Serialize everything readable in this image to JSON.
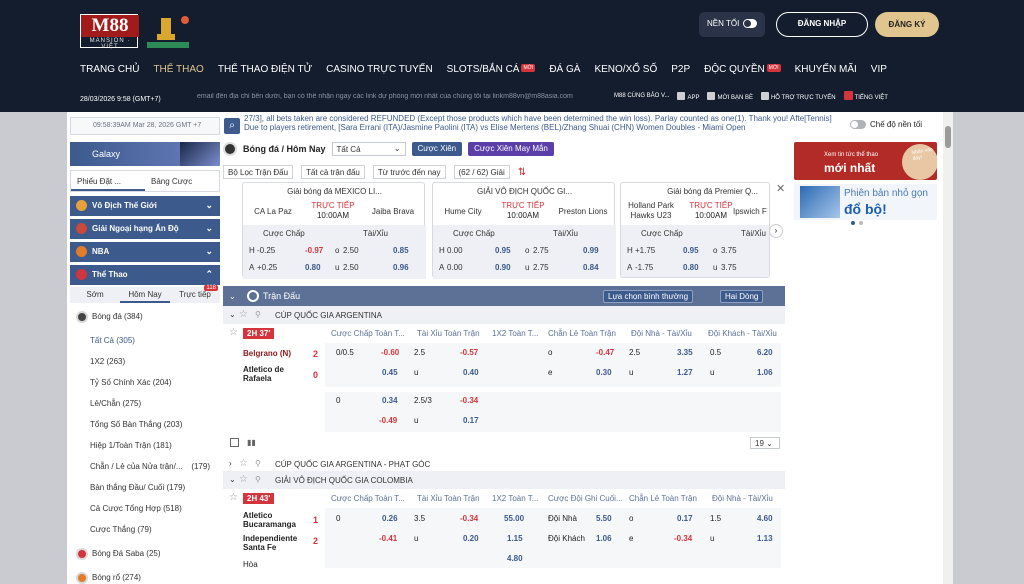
{
  "brand": {
    "logo": "M88",
    "logo_sub": "MANSION · VIỆT"
  },
  "header": {
    "theme_label": "NỀN TỐI",
    "login": "ĐĂNG NHẬP",
    "register": "ĐĂNG KÝ"
  },
  "nav": [
    {
      "label": "TRANG CHỦ",
      "badge": ""
    },
    {
      "label": "THỂ THAO",
      "badge": ""
    },
    {
      "label": "THỂ THAO ĐIỆN TỬ",
      "badge": ""
    },
    {
      "label": "CASINO TRỰC TUYẾN",
      "badge": ""
    },
    {
      "label": "SLOTS/BẮN CÁ",
      "badge": "MỚI"
    },
    {
      "label": "ĐÁ GÀ",
      "badge": ""
    },
    {
      "label": "KENO/XỔ SỐ",
      "badge": ""
    },
    {
      "label": "P2P",
      "badge": ""
    },
    {
      "label": "ĐỘC QUYỀN",
      "badge": "MỚI"
    },
    {
      "label": "KHUYẾN MÃI",
      "badge": ""
    },
    {
      "label": "VIP",
      "badge": ""
    }
  ],
  "infobar": {
    "datetime": "28/03/2026 9:58 (GMT+7)",
    "marquee": "email đến địa chỉ bên dưới, bạn có thể nhận ngay các link dự phòng mới nhất của chúng tôi tại linkm88vn@m88asia.com",
    "links": [
      "M88 CÙNG BẢO V...",
      "APP",
      "MỜI BẠN BÈ",
      "HỖ TRỢ TRỰC TUYẾN",
      "TIẾNG VIỆT"
    ]
  },
  "topbar": {
    "clock": "09:58:39AM Mar 28, 2026 GMT +7",
    "announcement": "27/3], all bets taken are considered REFUNDED (Except those products which have been determined the win loss). Parlay counted as one(1). Thank you! Afte[Tennis] Due to players retirement, [Sara Errani (ITA)/Jasmine Paolini (ITA) vs Elise Mertens (BEL)/Zhang Shuai (CHN) Women Doubles - Miami Open",
    "night_mode": "Chế độ nền tối"
  },
  "sidebar": {
    "galaxy": "Galaxy",
    "tabs": [
      "Phiếu Đặt ...",
      "Bảng Cược"
    ],
    "sections": [
      "Vô Địch Thế Giới",
      "Giải Ngoại hạng Ấn Độ",
      "NBA",
      "Thể Thao"
    ],
    "subtabs": [
      "Sớm",
      "Hôm Nay",
      "Trực tiếp"
    ],
    "live_count": "118",
    "items": [
      {
        "label": "Bóng đá",
        "count": "(384)"
      },
      {
        "label": "Tất Cả",
        "count": "(305)"
      },
      {
        "label": "1X2",
        "count": "(263)"
      },
      {
        "label": "Tỷ Số Chính Xác",
        "count": "(204)"
      },
      {
        "label": "Lẻ/Chẵn",
        "count": "(275)"
      },
      {
        "label": "Tổng Số Bàn Thắng",
        "count": "(203)"
      },
      {
        "label": "Hiệp 1/Toàn Trận",
        "count": "(181)"
      },
      {
        "label": "Chẵn / Lẻ của Nửa trận/...",
        "count": "(179)"
      },
      {
        "label": "Bàn thắng Đầu/ Cuối",
        "count": "(179)"
      },
      {
        "label": "Cả Cược Tổng Hợp",
        "count": "(518)"
      },
      {
        "label": "Cược Thắng",
        "count": "(79)"
      },
      {
        "label": "Bóng Đá Saba",
        "count": "(25)"
      },
      {
        "label": "Bóng rổ",
        "count": "(274)"
      }
    ]
  },
  "center": {
    "title": "Bóng đá / Hôm Nay",
    "select": "Tất Cả",
    "btn_parlay": "Cược Xiên",
    "btn_lucky": "Cược Xiên May Mắn",
    "filters": [
      "Bộ Lọc Trận Đấu",
      "Tất cả trận đấu",
      "Từ trước đến nay",
      "(62 / 62) Giải"
    ],
    "highlights": [
      {
        "league": "Giải bóng đá MEXICO LI...",
        "home": "CA La Paz",
        "away": "Jaiba Brava",
        "live": "TRỰC TIẾP",
        "time": "10:00AM",
        "hdp_label": "Cược Chấp",
        "ou_label": "Tài/Xỉu",
        "r1": [
          "H",
          "-0.25",
          "-0.97",
          "o",
          "2.50",
          "0.85"
        ],
        "r2": [
          "A",
          "+0.25",
          "0.80",
          "u",
          "2.50",
          "0.96"
        ]
      },
      {
        "league": "GIẢI VÔ ĐỊCH QUỐC GI...",
        "home": "Hume City",
        "away": "Preston Lions",
        "live": "TRỰC TIẾP",
        "time": "10:00AM",
        "hdp_label": "Cược Chấp",
        "ou_label": "Tài/Xỉu",
        "r1": [
          "H",
          "0.00",
          "0.95",
          "o",
          "2.75",
          "0.99"
        ],
        "r2": [
          "A",
          "0.00",
          "0.90",
          "u",
          "2.75",
          "0.84"
        ]
      },
      {
        "league": "Giải bóng đá Premier Q...",
        "home": "Holland Park Hawks U23",
        "away": "Ipswich F",
        "live": "TRỰC TIẾP",
        "time": "10:00AM",
        "hdp_label": "Cược Chấp",
        "ou_label": "Tài/Xỉu",
        "r1": [
          "H",
          "+1.75",
          "0.95",
          "o",
          "3.75",
          ""
        ],
        "r2": [
          "A",
          "-1.75",
          "0.80",
          "u",
          "3.75",
          ""
        ]
      }
    ],
    "bar": {
      "title": "Trận Đấu",
      "sort": "Lựa chọn bình thường",
      "mode": "Hai Dòng"
    },
    "league1": "CÚP QUỐC GIA ARGENTINA",
    "match1": {
      "live": "2H 37'",
      "cols": [
        "Cược Chấp Toàn T...",
        "Tài Xỉu Toàn Trận",
        "1X2 Toàn T...",
        "Chẵn Lẻ Toàn Trận",
        "Đội Nhà - Tài/Xỉu",
        "Đội Khách - Tài/Xỉu"
      ],
      "home": "Belgrano (N)",
      "away": "Atletico de Rafaela",
      "home_score": "2",
      "away_score": "0",
      "r1": [
        "0/0.5",
        "-0.60",
        "2.5",
        "-0.57",
        "o",
        "-0.47",
        "2.5",
        "3.35",
        "0.5",
        "6.20"
      ],
      "r2": [
        "0.45",
        "u",
        "0.40",
        "e",
        "0.30",
        "u",
        "1.27",
        "u",
        "1.06"
      ],
      "r3": [
        "0",
        "0.34",
        "2.5/3",
        "-0.34"
      ],
      "r4": [
        "-0.49",
        "u",
        "0.17"
      ]
    },
    "page_size": "19",
    "league2": "CÚP QUỐC GIA ARGENTINA - PHẠT GÓC",
    "league3": "GIẢI VÔ ĐỊCH QUỐC GIA COLOMBIA",
    "match2": {
      "live": "2H 43'",
      "cols": [
        "Cược Chấp Toàn T...",
        "Tài Xỉu Toàn Trận",
        "1X2 Toàn T...",
        "Cược Đội Ghi Cuối...",
        "Chẵn Lẻ Toàn Trận",
        "Đội Nhà - Tài/Xỉu"
      ],
      "home": "Atletico Bucaramanga",
      "away": "Independiente Santa Fe",
      "draw": "Hòa",
      "home_score": "1",
      "away_score": "2",
      "r1": [
        "0",
        "0.26",
        "3.5",
        "-0.34",
        "55.00",
        "Đội Nhà",
        "5.50",
        "o",
        "0.17",
        "1.5",
        "4.60"
      ],
      "r2": [
        "-0.41",
        "u",
        "0.20",
        "1.15",
        "Đội Khách",
        "1.06",
        "e",
        "-0.34",
        "u",
        "1.13"
      ],
      "r3": [
        "4.80"
      ]
    }
  },
  "ads": {
    "ad1_line1": "Xem tin tức thể thao",
    "ad1_line2": "mới nhất",
    "ad1_badge": "Nhấn vào đây!",
    "ad2_line1": "Phiên bản nhỏ gọn",
    "ad2_line2": "đổ bộ!"
  },
  "colors": {
    "header_bg": "#141d2e",
    "gold": "#e0c58e",
    "blue": "#3c5a8c",
    "red": "#d4343b"
  }
}
